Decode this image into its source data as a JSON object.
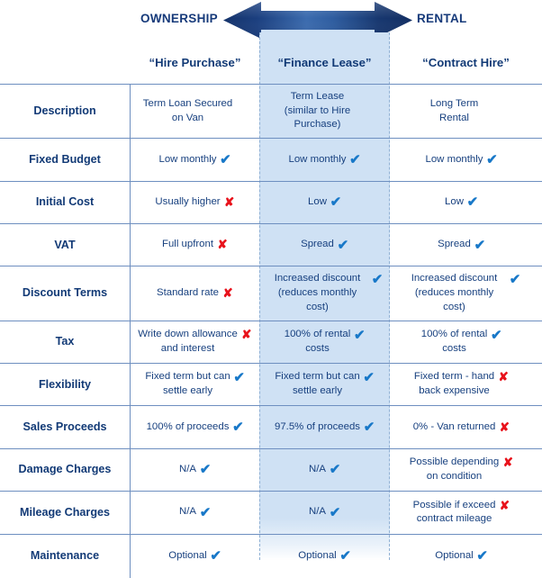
{
  "banner": {
    "left_label": "OWNERSHIP",
    "right_label": "RENTAL",
    "arrow_icon": "double-headed-arrow-icon",
    "arrow_color_dark": "#16356f",
    "arrow_color_light": "#cfe1f4"
  },
  "colors": {
    "navy": "#123a76",
    "text_blue": "#17407f",
    "rule": "#6e8fc0",
    "highlight_band": "#cfe1f4",
    "tick": "#1878c8",
    "cross": "#e8121b"
  },
  "table": {
    "row_label_header": "",
    "columns": [
      {
        "key": "hire_purchase",
        "label": "“Hire Purchase”",
        "highlighted": false
      },
      {
        "key": "finance_lease",
        "label": "“Finance Lease”",
        "highlighted": true
      },
      {
        "key": "contract_hire",
        "label": "“Contract Hire”",
        "highlighted": false
      }
    ],
    "rows": [
      {
        "label": "Description",
        "cells": [
          {
            "lines": [
              "Term Loan Secured",
              "on Van"
            ],
            "mark": "none"
          },
          {
            "lines": [
              "Term Lease",
              "(similar to Hire Purchase)"
            ],
            "mark": "none"
          },
          {
            "lines": [
              "Long Term",
              "Rental"
            ],
            "mark": "none"
          }
        ]
      },
      {
        "label": "Fixed Budget",
        "cells": [
          {
            "lines": [
              "Low monthly"
            ],
            "mark": "tick"
          },
          {
            "lines": [
              "Low monthly"
            ],
            "mark": "tick"
          },
          {
            "lines": [
              "Low monthly"
            ],
            "mark": "tick"
          }
        ]
      },
      {
        "label": "Initial Cost",
        "cells": [
          {
            "lines": [
              "Usually higher"
            ],
            "mark": "cross"
          },
          {
            "lines": [
              "Low"
            ],
            "mark": "tick"
          },
          {
            "lines": [
              "Low"
            ],
            "mark": "tick"
          }
        ]
      },
      {
        "label": "VAT",
        "cells": [
          {
            "lines": [
              "Full upfront"
            ],
            "mark": "cross"
          },
          {
            "lines": [
              "Spread"
            ],
            "mark": "tick"
          },
          {
            "lines": [
              "Spread"
            ],
            "mark": "tick"
          }
        ]
      },
      {
        "label": "Discount Terms",
        "cells": [
          {
            "lines": [
              "Standard rate"
            ],
            "mark": "cross"
          },
          {
            "lines": [
              "Increased discount",
              "(reduces monthly cost)"
            ],
            "mark": "tick",
            "mark_top": true
          },
          {
            "lines": [
              "Increased discount",
              "(reduces monthly cost)"
            ],
            "mark": "tick",
            "mark_top": true
          }
        ]
      },
      {
        "label": "Tax",
        "cells": [
          {
            "lines": [
              "Write down allowance",
              "and interest"
            ],
            "mark": "cross",
            "mark_top": true
          },
          {
            "lines": [
              "100% of rental",
              "costs"
            ],
            "mark": "tick",
            "mark_top": true
          },
          {
            "lines": [
              "100% of rental",
              "costs"
            ],
            "mark": "tick",
            "mark_top": true
          }
        ]
      },
      {
        "label": "Flexibility",
        "cells": [
          {
            "lines": [
              "Fixed term but can",
              "settle early"
            ],
            "mark": "tick",
            "mark_top": true
          },
          {
            "lines": [
              "Fixed term but can",
              "settle early"
            ],
            "mark": "tick",
            "mark_top": true
          },
          {
            "lines": [
              "Fixed term - hand",
              "back expensive"
            ],
            "mark": "cross",
            "mark_top": true
          }
        ]
      },
      {
        "label": "Sales Proceeds",
        "cells": [
          {
            "lines": [
              "100% of proceeds"
            ],
            "mark": "tick"
          },
          {
            "lines": [
              "97.5% of proceeds"
            ],
            "mark": "tick"
          },
          {
            "lines": [
              "0% - Van returned"
            ],
            "mark": "cross"
          }
        ]
      },
      {
        "label": "Damage Charges",
        "cells": [
          {
            "lines": [
              "N/A"
            ],
            "mark": "tick"
          },
          {
            "lines": [
              "N/A"
            ],
            "mark": "tick"
          },
          {
            "lines": [
              "Possible depending",
              "on condition"
            ],
            "mark": "cross",
            "mark_top": true
          }
        ]
      },
      {
        "label": "Mileage Charges",
        "cells": [
          {
            "lines": [
              "N/A"
            ],
            "mark": "tick"
          },
          {
            "lines": [
              "N/A"
            ],
            "mark": "tick"
          },
          {
            "lines": [
              "Possible if exceed",
              "contract mileage"
            ],
            "mark": "cross",
            "mark_top": true
          }
        ]
      },
      {
        "label": "Maintenance",
        "cells": [
          {
            "lines": [
              "Optional"
            ],
            "mark": "tick"
          },
          {
            "lines": [
              "Optional"
            ],
            "mark": "tick"
          },
          {
            "lines": [
              "Optional"
            ],
            "mark": "tick"
          }
        ]
      }
    ],
    "marks": {
      "tick": "✔",
      "cross": "✘",
      "none": ""
    }
  }
}
